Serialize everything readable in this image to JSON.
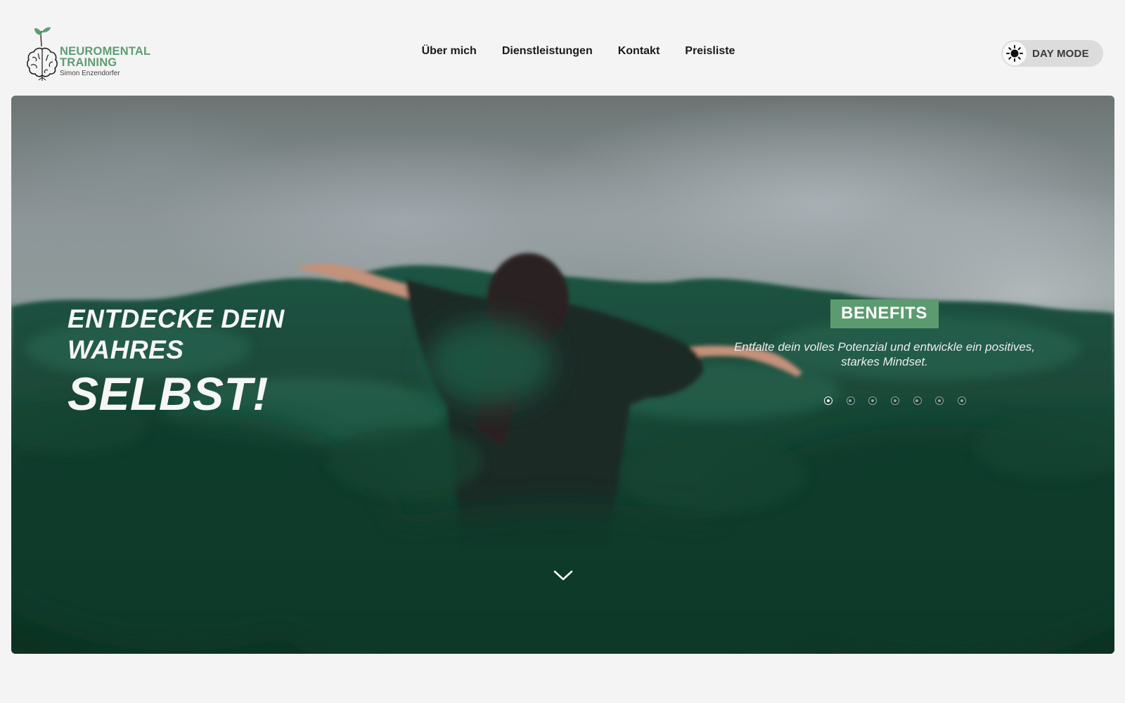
{
  "header": {
    "logo": {
      "line1": "NEUROMENTAL",
      "line2": "TRAINING",
      "subtitle": "Simon Enzendorfer",
      "icon": "brain-sprout-icon"
    },
    "nav": [
      {
        "label": "Über mich"
      },
      {
        "label": "Dienstleistungen"
      },
      {
        "label": "Kontakt"
      },
      {
        "label": "Preisliste"
      }
    ],
    "mode_toggle": {
      "label": "DAY MODE",
      "icon": "sun-icon"
    }
  },
  "hero": {
    "headline_line1": "ENTDECKE DEIN",
    "headline_line2": "WAHRES",
    "headline_line3": "SELBST!",
    "slide": {
      "badge": "BENEFITS",
      "text": "Entfalte dein volles Potenzial und entwickle ein positives, starkes Mindset."
    },
    "slider": {
      "total": 7,
      "active_index": 0
    },
    "scroll_icon": "chevron-down-icon"
  },
  "colors": {
    "accent_green": "#5c9b70",
    "page_background": "#f4f4f4",
    "toggle_background": "#dcdcdc"
  }
}
